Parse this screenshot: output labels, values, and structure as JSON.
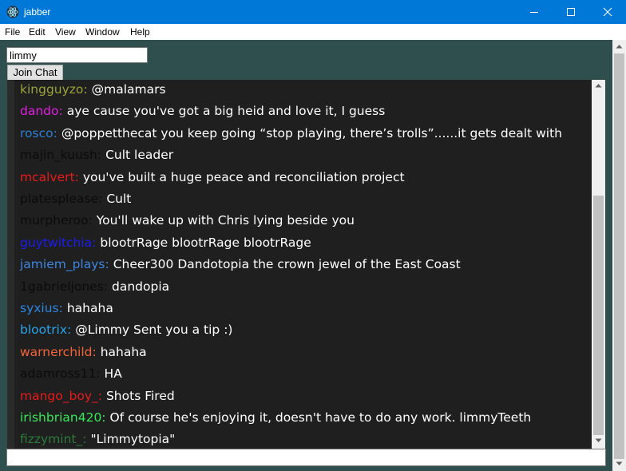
{
  "window": {
    "title": "jabber",
    "icon": "electron-atom-icon"
  },
  "menu": {
    "items": [
      "File",
      "Edit",
      "View",
      "Window",
      "Help"
    ]
  },
  "join": {
    "username_value": "limmy",
    "button_label": "Join Chat"
  },
  "messages": [
    {
      "user": "kingguyzo:",
      "text": "@malamars",
      "color": "#9aa33a"
    },
    {
      "user": "dando:",
      "text": "aye cause you've got a big heid and love it, I guess",
      "color": "#e11fe0"
    },
    {
      "user": "rosco:",
      "text": "@poppetthecat you keep going “stop playing, there’s trolls”......it gets dealt with",
      "color": "#2f7fd0"
    },
    {
      "user": "majin_kuush:",
      "text": "Cult leader",
      "color": "#0b0b0b"
    },
    {
      "user": "mcalvert:",
      "text": "you've built a huge peace and reconciliation project",
      "color": "#e81b1b"
    },
    {
      "user": "platesplease:",
      "text": "Cult",
      "color": "#0b0b0b"
    },
    {
      "user": "murpheroo:",
      "text": "You'll wake up with Chris lying beside you",
      "color": "#0b0b0b"
    },
    {
      "user": "guytwitchia:",
      "text": "blootrRage blootrRage blootrRage",
      "color": "#1c1cf0"
    },
    {
      "user": "jamiem_plays:",
      "text": "Cheer300 Dandotopia the crown jewel of the East Coast",
      "color": "#3f86df"
    },
    {
      "user": "1gabrieljones:",
      "text": "dandopia",
      "color": "#0b0b0b"
    },
    {
      "user": "syxius:",
      "text": "hahaha",
      "color": "#2f86e0"
    },
    {
      "user": "blootrix:",
      "text": "@Limmy Sent you a tip :)",
      "color": "#27a3e8"
    },
    {
      "user": "warnerchild:",
      "text": "hahaha",
      "color": "#f2653a"
    },
    {
      "user": "adamross11:",
      "text": "HA",
      "color": "#0b0b0b"
    },
    {
      "user": "mango_boy_:",
      "text": "Shots Fired",
      "color": "#e81b1b"
    },
    {
      "user": "irishbrian420:",
      "text": "Of course he's enjoying it, doesn't have to do any work. limmyTeeth",
      "color": "#39e85a"
    },
    {
      "user": "fizzymint_:",
      "text": "\"Limmytopia\"",
      "color": "#2c7a3c"
    }
  ],
  "chat_input": {
    "value": ""
  }
}
